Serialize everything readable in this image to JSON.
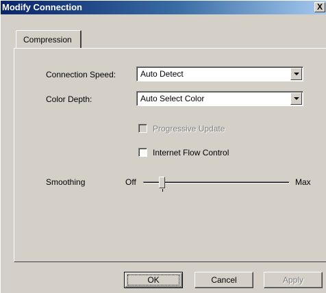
{
  "window": {
    "title": "Modify Connection",
    "close_glyph": "X"
  },
  "tabs": [
    {
      "label": "Compression"
    }
  ],
  "form": {
    "connection_speed": {
      "label": "Connection Speed:",
      "value": "Auto Detect"
    },
    "color_depth": {
      "label": "Color Depth:",
      "value": "Auto Select Color"
    },
    "progressive_update": {
      "label": "Progressive Update",
      "checked": false,
      "enabled": false
    },
    "internet_flow_control": {
      "label": "Internet Flow Control",
      "checked": false,
      "enabled": true
    },
    "smoothing": {
      "label": "Smoothing",
      "min_label": "Off",
      "max_label": "Max",
      "level_fraction": 0.13
    }
  },
  "buttons": {
    "ok": "OK",
    "cancel": "Cancel",
    "apply": "Apply"
  },
  "colors": {
    "face": "#d4d0c8",
    "title_start": "#0a246a",
    "title_end": "#a6caf0",
    "disabled_text": "#808080"
  },
  "icons": {
    "combo_arrow": "chevron-down-icon"
  }
}
